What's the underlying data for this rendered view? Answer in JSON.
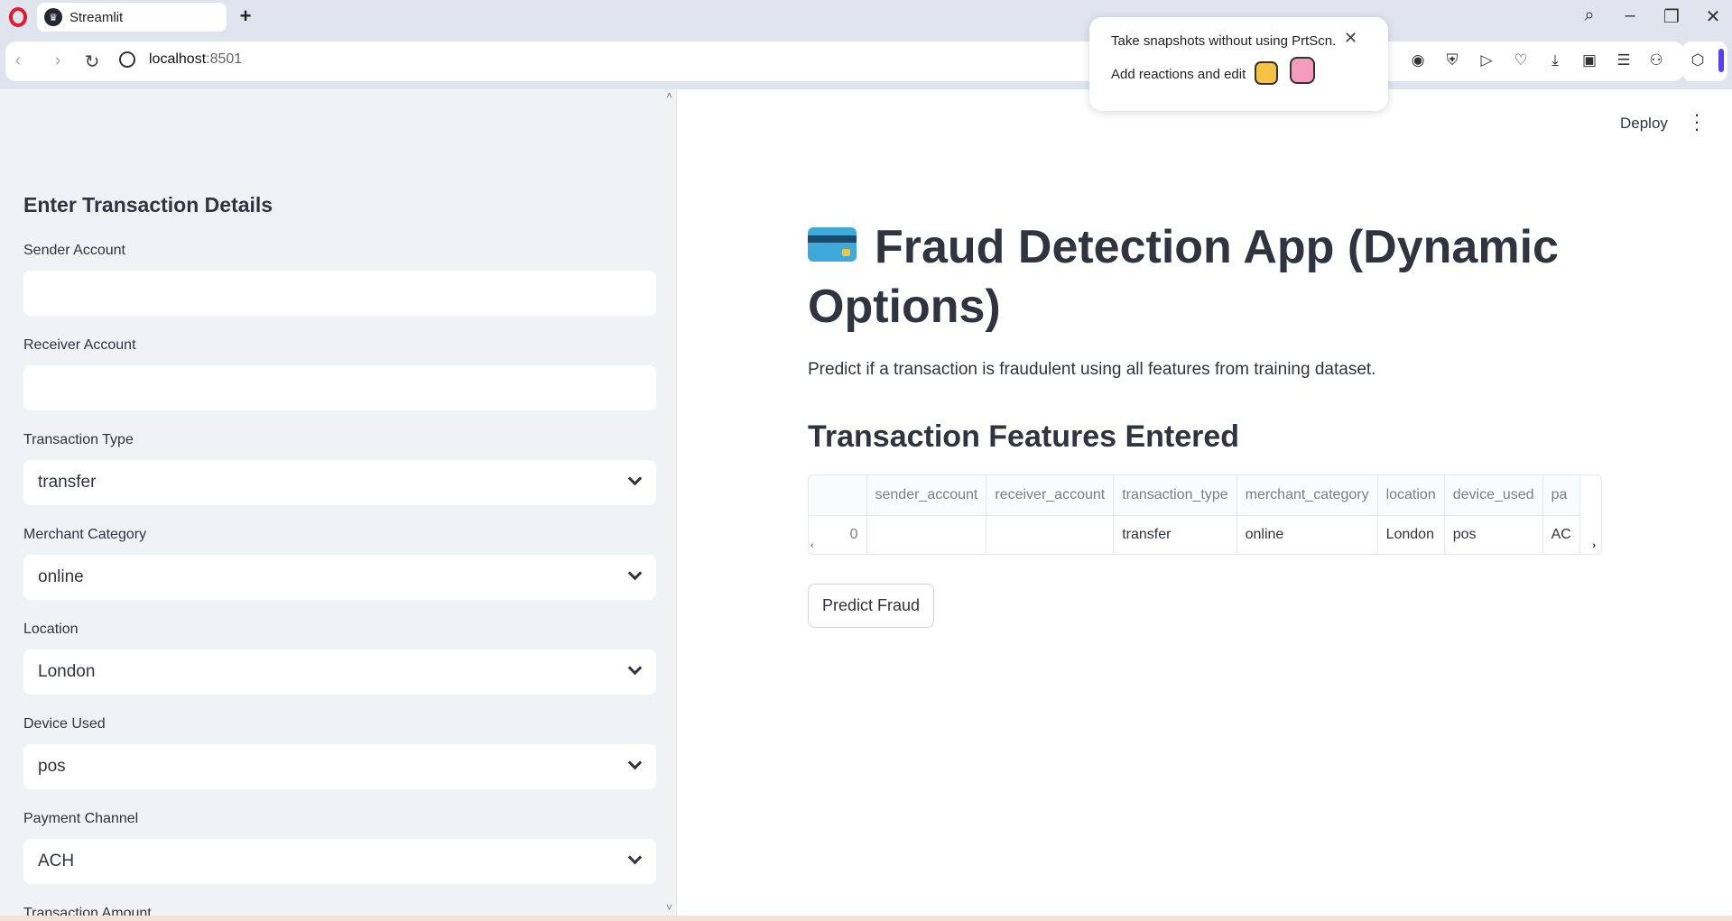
{
  "browser": {
    "tab_title": "Streamlit",
    "url_host": "localhost",
    "url_port": ":8501"
  },
  "popup": {
    "line1": "Take snapshots without using PrtScn.",
    "line2": "Add reactions and edit"
  },
  "header": {
    "deploy_label": "Deploy"
  },
  "sidebar": {
    "heading": "Enter Transaction Details",
    "fields": {
      "sender_account": {
        "label": "Sender Account",
        "value": ""
      },
      "receiver_account": {
        "label": "Receiver Account",
        "value": ""
      },
      "transaction_type": {
        "label": "Transaction Type",
        "value": "transfer"
      },
      "merchant_category": {
        "label": "Merchant Category",
        "value": "online"
      },
      "location": {
        "label": "Location",
        "value": "London"
      },
      "device_used": {
        "label": "Device Used",
        "value": "pos"
      },
      "payment_channel": {
        "label": "Payment Channel",
        "value": "ACH"
      },
      "transaction_amount": {
        "label": "Transaction Amount"
      }
    }
  },
  "main": {
    "title": "Fraud Detection App (Dynamic Options)",
    "subtitle": "Predict if a transaction is fraudulent using all features from training dataset.",
    "section_heading": "Transaction Features Entered",
    "table": {
      "columns": [
        "",
        "sender_account",
        "receiver_account",
        "transaction_type",
        "merchant_category",
        "location",
        "device_used",
        "pa"
      ],
      "rows": [
        [
          "0",
          "",
          "",
          "transfer",
          "online",
          "London",
          "pos",
          "AC"
        ]
      ]
    },
    "predict_button": "Predict Fraud"
  }
}
